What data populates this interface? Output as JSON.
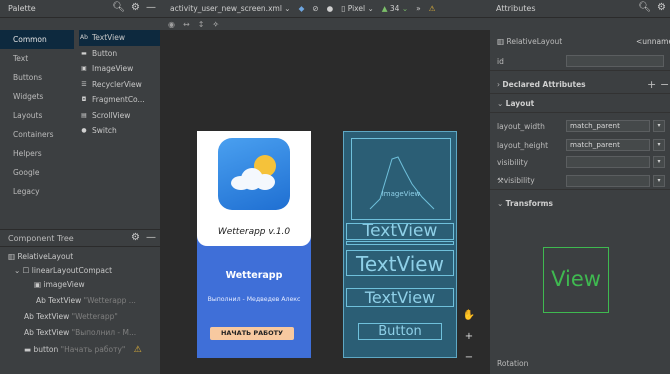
{
  "palette": {
    "title": "Palette",
    "categories": [
      "Common",
      "Text",
      "Buttons",
      "Widgets",
      "Layouts",
      "Containers",
      "Helpers",
      "Google",
      "Legacy"
    ],
    "widgets": [
      {
        "icon": "Ab",
        "label": "TextView"
      },
      {
        "icon": "▬",
        "label": "Button"
      },
      {
        "icon": "▣",
        "label": "ImageView"
      },
      {
        "icon": "☰",
        "label": "RecyclerView"
      },
      {
        "icon": "◘",
        "label": "FragmentCo..."
      },
      {
        "icon": "▤",
        "label": "ScrollView"
      },
      {
        "icon": "●",
        "label": "Switch"
      }
    ]
  },
  "tree": {
    "title": "Component Tree",
    "items": [
      {
        "label": "RelativeLayout",
        "extra": ""
      },
      {
        "label": "linearLayoutCompact",
        "extra": ""
      },
      {
        "label": "imageView",
        "extra": ""
      },
      {
        "label": "TextView",
        "extra": "\"Wetterapp ..."
      },
      {
        "label": "TextView",
        "extra": "\"Wetterapp\""
      },
      {
        "label": "TextView",
        "extra": "\"Выполнил - М..."
      },
      {
        "label": "button",
        "extra": "\"Начать работу\""
      }
    ]
  },
  "toolbar": {
    "file": "activity_user_new_screen.xml",
    "device": "Pixel",
    "api": "34"
  },
  "phone": {
    "title": "Wetterapp v.1.0",
    "app_name": "Wetterapp",
    "author": "Выполнил - Медведев Алекс",
    "button": "НАЧАТЬ РАБОТУ"
  },
  "blueprint": {
    "image_label": "ImageView",
    "tv1": "TextView",
    "tv2": "TextView",
    "tv3": "TextView",
    "button": "Button"
  },
  "attributes": {
    "title": "Attributes",
    "component": "RelativeLayout",
    "component_name": "<unname",
    "id_label": "id",
    "declared": "Declared Attributes",
    "layout_section": "Layout",
    "layout_width_label": "layout_width",
    "layout_width_value": "match_parent",
    "layout_height_label": "layout_height",
    "layout_height_value": "match_parent",
    "visibility_label": "visibility",
    "tools_visibility_label": "visibility",
    "transforms_section": "Transforms",
    "preview_label": "View",
    "rotation_label": "Rotation"
  },
  "colors": {
    "accent": "#3f6fd8",
    "blueprint": "#2b5e75",
    "button": "#f7c9a0",
    "view_preview": "#3fb950"
  }
}
